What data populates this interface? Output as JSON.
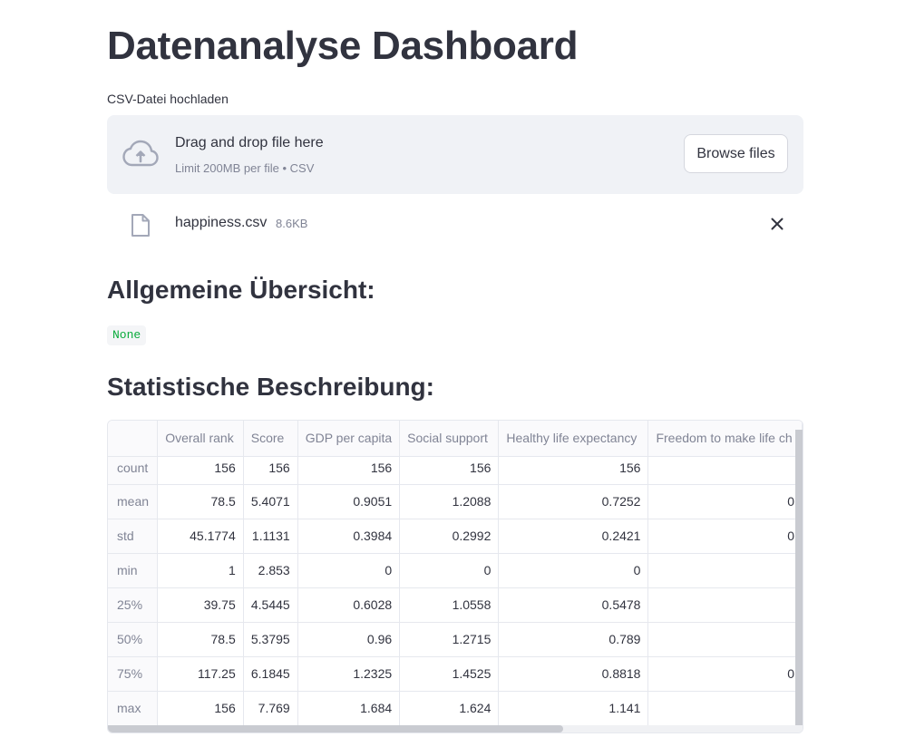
{
  "page": {
    "title": "Datenanalyse Dashboard"
  },
  "uploader": {
    "label": "CSV-Datei hochladen",
    "drop_title": "Drag and drop file here",
    "drop_limit": "Limit 200MB per file • CSV",
    "browse_label": "Browse files",
    "upload_icon": "cloud-upload-icon"
  },
  "uploaded_file": {
    "name": "happiness.csv",
    "size": "8.6KB",
    "file_icon": "file-icon",
    "remove_icon": "close-icon"
  },
  "overview": {
    "heading": "Allgemeine Übersicht:",
    "value": "None"
  },
  "stats": {
    "heading": "Statistische Beschreibung:",
    "columns": [
      "Overall rank",
      "Score",
      "GDP per capita",
      "Social support",
      "Healthy life expectancy",
      "Freedom to make life ch"
    ],
    "rows": [
      {
        "label": "count",
        "values": [
          "156",
          "156",
          "156",
          "156",
          "156",
          ""
        ]
      },
      {
        "label": "mean",
        "values": [
          "78.5",
          "5.4071",
          "0.9051",
          "1.2088",
          "0.7252",
          "0"
        ]
      },
      {
        "label": "std",
        "values": [
          "45.1774",
          "1.1131",
          "0.3984",
          "0.2992",
          "0.2421",
          "0"
        ]
      },
      {
        "label": "min",
        "values": [
          "1",
          "2.853",
          "0",
          "0",
          "0",
          ""
        ]
      },
      {
        "label": "25%",
        "values": [
          "39.75",
          "4.5445",
          "0.6028",
          "1.0558",
          "0.5478",
          ""
        ]
      },
      {
        "label": "50%",
        "values": [
          "78.5",
          "5.3795",
          "0.96",
          "1.2715",
          "0.789",
          ""
        ]
      },
      {
        "label": "75%",
        "values": [
          "117.25",
          "6.1845",
          "1.2325",
          "1.4525",
          "0.8818",
          "0"
        ]
      },
      {
        "label": "max",
        "values": [
          "156",
          "7.769",
          "1.684",
          "1.624",
          "1.141",
          ""
        ]
      }
    ]
  },
  "colors": {
    "text": "#31333f",
    "muted": "#808495",
    "dropzone_bg": "#f0f2f6",
    "code_green": "#09ab3b"
  }
}
